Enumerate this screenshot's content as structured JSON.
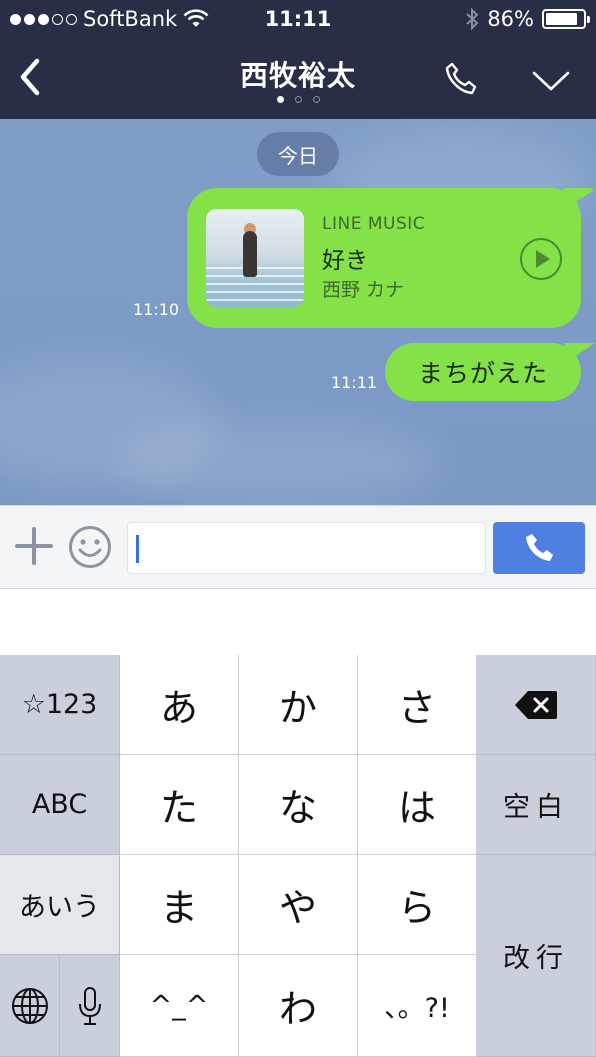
{
  "status_bar": {
    "carrier": "SoftBank",
    "time": "11:11",
    "battery_percent": "86%",
    "battery_level": 0.86
  },
  "nav": {
    "title": "西牧裕太",
    "page_count": 3,
    "active_page": 1
  },
  "chat": {
    "date_label": "今日",
    "messages": [
      {
        "type": "music",
        "source_label": "LINE MUSIC",
        "song_title": "好き",
        "artist": "西野 カナ",
        "time": "11:10"
      },
      {
        "type": "text",
        "text": "まちがえた",
        "time": "11:11"
      }
    ]
  },
  "input": {
    "value": ""
  },
  "keyboard": {
    "row1": [
      "☆123",
      "あ",
      "か",
      "さ"
    ],
    "row2": [
      "ABC",
      "た",
      "な",
      "は",
      "空白"
    ],
    "row3": [
      "あいう",
      "ま",
      "や",
      "ら",
      "改行"
    ],
    "row4": [
      "^_^",
      "わ",
      "、。?!"
    ]
  },
  "colors": {
    "header_bg": "#272e45",
    "bubble_green": "#84e148",
    "send_blue": "#4f7fe0",
    "chat_bg": "#7f9dc7"
  },
  "icons": [
    "back-chevron-icon",
    "phone-icon",
    "dropdown-chevron-icon",
    "plus-icon",
    "smiley-icon",
    "phone-send-icon",
    "play-icon",
    "delete-icon",
    "globe-icon",
    "microphone-icon",
    "wifi-icon",
    "bluetooth-icon"
  ]
}
